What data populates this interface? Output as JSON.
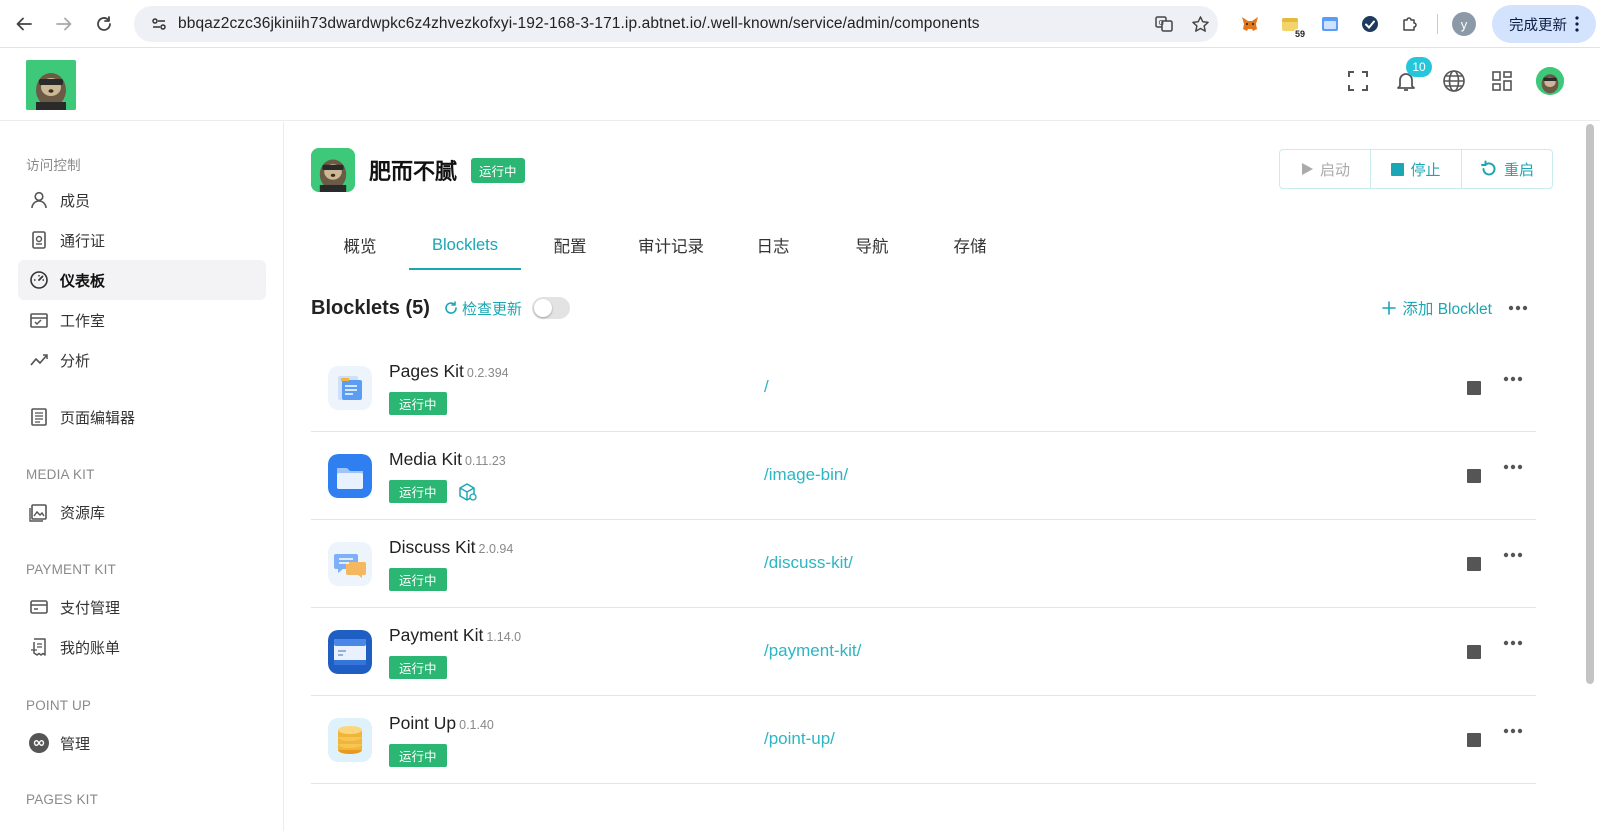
{
  "browser": {
    "url": "bbqaz2czc36jkiniih73dwardwpkc6z4zhvezkofxyi-192-168-3-171.ip.abtnet.io/.well-known/service/admin/components",
    "extension_badge": "59",
    "profile_initial": "y",
    "update_label": "完成更新"
  },
  "header": {
    "notification_count": "10"
  },
  "sidebar": {
    "groups": [
      {
        "label": "访问控制"
      },
      {
        "label": "MEDIA KIT"
      },
      {
        "label": "PAYMENT KIT"
      },
      {
        "label": "POINT UP"
      },
      {
        "label": "PAGES KIT"
      }
    ],
    "items": [
      {
        "label": "成员",
        "icon": "user-icon"
      },
      {
        "label": "通行证",
        "icon": "passport-icon"
      },
      {
        "label": "仪表板",
        "icon": "dashboard-icon",
        "active": true
      },
      {
        "label": "工作室",
        "icon": "studio-icon"
      },
      {
        "label": "分析",
        "icon": "analytics-icon"
      },
      {
        "label": "页面编辑器",
        "icon": "page-editor-icon"
      },
      {
        "label": "资源库",
        "icon": "media-library-icon"
      },
      {
        "label": "支付管理",
        "icon": "payment-card-icon"
      },
      {
        "label": "我的账单",
        "icon": "bill-icon"
      },
      {
        "label": "管理",
        "icon": "infinity-icon"
      }
    ]
  },
  "app": {
    "name": "肥而不腻",
    "status": "运行中",
    "controls": {
      "start": "启动",
      "stop": "停止",
      "restart": "重启"
    }
  },
  "tabs": [
    {
      "label": "概览"
    },
    {
      "label": "Blocklets",
      "active": true
    },
    {
      "label": "配置"
    },
    {
      "label": "审计记录"
    },
    {
      "label": "日志"
    },
    {
      "label": "导航"
    },
    {
      "label": "存储"
    }
  ],
  "blocklets": {
    "title": "Blocklets (5)",
    "check_update": "检查更新",
    "add_label": "添加 Blocklet",
    "items": [
      {
        "name": "Pages Kit",
        "version": "0.2.394",
        "status": "运行中",
        "path": "/"
      },
      {
        "name": "Media Kit",
        "version": "0.11.23",
        "status": "运行中",
        "path": "/image-bin/"
      },
      {
        "name": "Discuss Kit",
        "version": "2.0.94",
        "status": "运行中",
        "path": "/discuss-kit/"
      },
      {
        "name": "Payment Kit",
        "version": "1.14.0",
        "status": "运行中",
        "path": "/payment-kit/"
      },
      {
        "name": "Point Up",
        "version": "0.1.40",
        "status": "运行中",
        "path": "/point-up/"
      }
    ]
  },
  "colors": {
    "accent": "#1aa6b3",
    "running": "#2bb673"
  }
}
